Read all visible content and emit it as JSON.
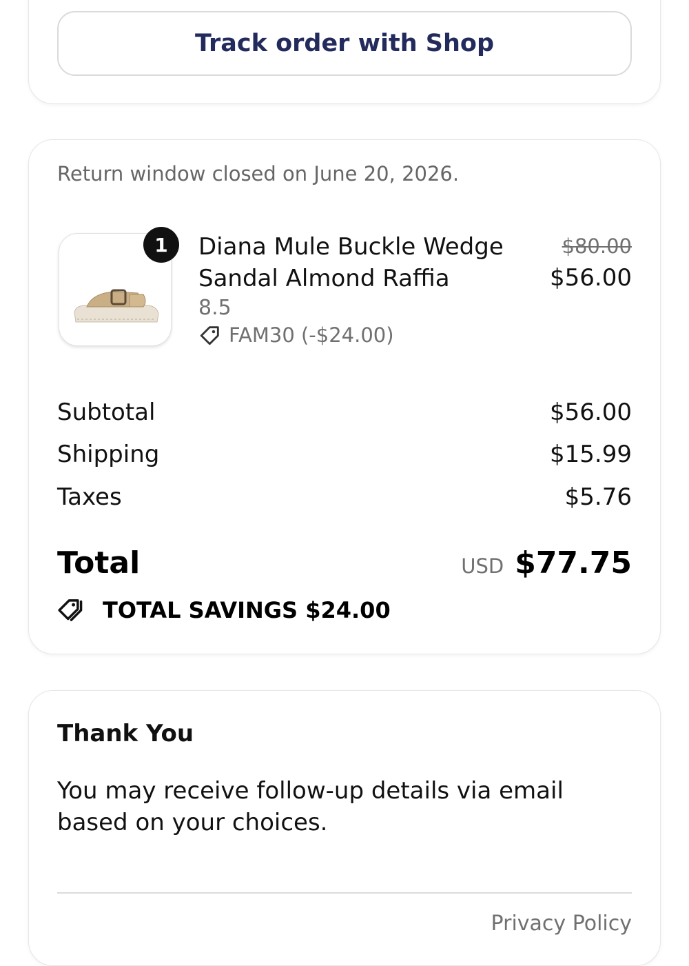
{
  "track": {
    "button_label": "Track order with Shop"
  },
  "order": {
    "return_note": "Return window closed on June 20, 2026.",
    "item": {
      "quantity": "1",
      "name": "Diana Mule Buckle Wedge Sandal Almond Raffia",
      "size": "8.5",
      "discount": "FAM30 (-$24.00)",
      "original_price": "$80.00",
      "price": "$56.00",
      "image_icon": "sandal-product-image"
    },
    "summary": {
      "subtotal_label": "Subtotal",
      "subtotal_value": "$56.00",
      "shipping_label": "Shipping",
      "shipping_value": "$15.99",
      "taxes_label": "Taxes",
      "taxes_value": "$5.76",
      "total_label": "Total",
      "currency": "USD",
      "total_value": "$77.75",
      "savings": "TOTAL SAVINGS $24.00"
    }
  },
  "thanks": {
    "title": "Thank You",
    "body": "You may receive follow-up details via email based on your choices.",
    "footer_link": "Privacy Policy"
  },
  "colors": {
    "button_text": "#232a5c",
    "muted_text": "#707070",
    "badge_bg": "#111111"
  }
}
